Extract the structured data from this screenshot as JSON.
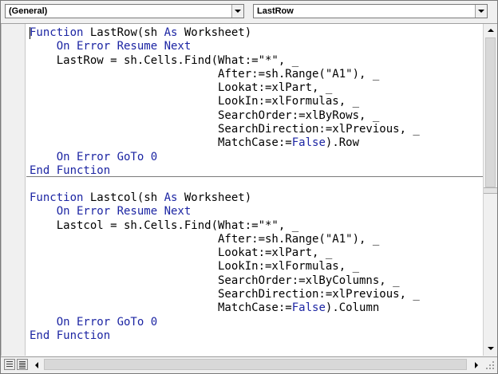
{
  "toolbar": {
    "object_combo": "(General)",
    "procedure_combo": "LastRow"
  },
  "colors": {
    "keyword": "#1c25a3",
    "code_text": "#000000",
    "background": "#ffffff"
  },
  "icons": {
    "object_dropdown": "chevron-down-icon",
    "procedure_dropdown": "chevron-down-icon",
    "scroll_up": "arrow-up-icon",
    "scroll_down": "arrow-down-icon",
    "scroll_left": "arrow-left-icon",
    "scroll_right": "arrow-right-icon",
    "procedure_view": "procedure-view-icon",
    "full_module_view": "full-module-view-icon"
  },
  "code": {
    "lastrow": [
      [
        {
          "t": "Function",
          "k": true
        },
        {
          "t": " LastRow(sh "
        },
        {
          "t": "As",
          "k": true
        },
        {
          "t": " Worksheet)"
        }
      ],
      [
        {
          "t": "    "
        },
        {
          "t": "On Error Resume Next",
          "k": true
        }
      ],
      [
        {
          "t": "    LastRow = sh.Cells.Find(What:=\"*\", _"
        }
      ],
      [
        {
          "t": "                            After:=sh.Range(\"A1\"), _"
        }
      ],
      [
        {
          "t": "                            Lookat:=xlPart, _"
        }
      ],
      [
        {
          "t": "                            LookIn:=xlFormulas, _"
        }
      ],
      [
        {
          "t": "                            SearchOrder:=xlByRows, _"
        }
      ],
      [
        {
          "t": "                            SearchDirection:=xlPrevious, _"
        }
      ],
      [
        {
          "t": "                            MatchCase:="
        },
        {
          "t": "False",
          "k": true
        },
        {
          "t": ").Row"
        }
      ],
      [
        {
          "t": "    "
        },
        {
          "t": "On Error GoTo",
          "k": true
        },
        {
          "t": " 0",
          "k": true
        }
      ],
      [
        {
          "t": "End Function",
          "k": true
        }
      ]
    ],
    "lastcol": [
      [
        {
          "t": "Function",
          "k": true
        },
        {
          "t": " Lastcol(sh "
        },
        {
          "t": "As",
          "k": true
        },
        {
          "t": " Worksheet)"
        }
      ],
      [
        {
          "t": "    "
        },
        {
          "t": "On Error Resume Next",
          "k": true
        }
      ],
      [
        {
          "t": "    Lastcol = sh.Cells.Find(What:=\"*\", _"
        }
      ],
      [
        {
          "t": "                            After:=sh.Range(\"A1\"), _"
        }
      ],
      [
        {
          "t": "                            Lookat:=xlPart, _"
        }
      ],
      [
        {
          "t": "                            LookIn:=xlFormulas, _"
        }
      ],
      [
        {
          "t": "                            SearchOrder:=xlByColumns, _"
        }
      ],
      [
        {
          "t": "                            SearchDirection:=xlPrevious, _"
        }
      ],
      [
        {
          "t": "                            MatchCase:="
        },
        {
          "t": "False",
          "k": true
        },
        {
          "t": ").Column"
        }
      ],
      [
        {
          "t": "    "
        },
        {
          "t": "On Error GoTo",
          "k": true
        },
        {
          "t": " 0",
          "k": true
        }
      ],
      [
        {
          "t": "End Function",
          "k": true
        }
      ]
    ]
  }
}
